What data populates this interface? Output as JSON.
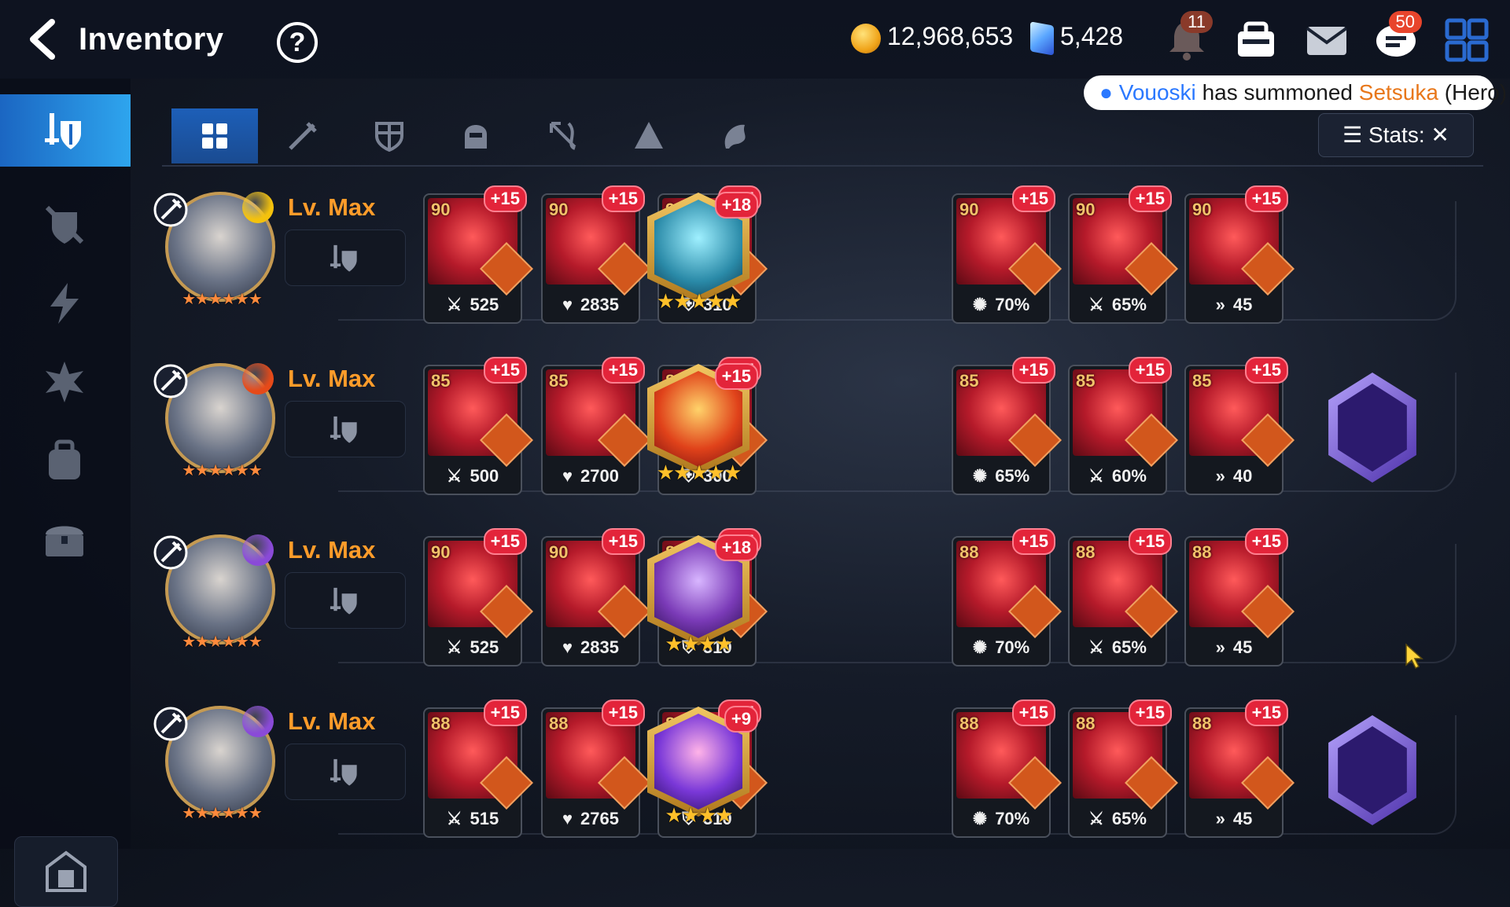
{
  "header": {
    "title": "Inventory",
    "help": "?",
    "gold": "12,968,653",
    "crystals": "5,428",
    "notification_count": "11",
    "chat_count": "50"
  },
  "tooltip": {
    "player": "Vouoski",
    "middle": "has summoned",
    "hero": "Setsuka",
    "suffix": "(Hero)"
  },
  "stats_button": {
    "label": "Stats:"
  },
  "sidebar": {
    "items": [
      "all-gear-icon",
      "no-gear-icon",
      "lightning-icon",
      "shatter-icon",
      "backpack-icon",
      "chest-icon"
    ],
    "bottom": "storage-icon"
  },
  "tabs": [
    "all",
    "weapon",
    "armor",
    "helmet",
    "bow",
    "accessory",
    "boots"
  ],
  "colors": {
    "accent": "#2ea5ee",
    "level": "#ff9c2a",
    "plus": "#e3243a"
  },
  "heroes": [
    {
      "level": "Lv. Max",
      "element": "light",
      "items": [
        {
          "lvl": "90",
          "plus": "+15",
          "stat_icon": "attack-icon",
          "stat": "525"
        },
        {
          "lvl": "90",
          "plus": "+15",
          "stat_icon": "health-icon",
          "stat": "2835"
        },
        {
          "lvl": "90",
          "plus": "+15",
          "stat_icon": "defense-icon",
          "stat": "310"
        },
        {
          "lvl": "90",
          "plus": "+15",
          "stat_icon": "crit-icon",
          "stat": "70%"
        },
        {
          "lvl": "90",
          "plus": "+15",
          "stat_icon": "attack-icon",
          "stat": "65%"
        },
        {
          "lvl": "90",
          "plus": "+15",
          "stat_icon": "speed-icon",
          "stat": "45"
        }
      ],
      "artifact_plus": "+18",
      "exclusive": false
    },
    {
      "level": "Lv. Max",
      "element": "fire",
      "items": [
        {
          "lvl": "85",
          "plus": "+15",
          "stat_icon": "attack-icon",
          "stat": "500"
        },
        {
          "lvl": "85",
          "plus": "+15",
          "stat_icon": "health-icon",
          "stat": "2700"
        },
        {
          "lvl": "85",
          "plus": "+15",
          "stat_icon": "defense-icon",
          "stat": "300"
        },
        {
          "lvl": "85",
          "plus": "+15",
          "stat_icon": "crit-icon",
          "stat": "65%"
        },
        {
          "lvl": "85",
          "plus": "+15",
          "stat_icon": "attack-icon",
          "stat": "60%"
        },
        {
          "lvl": "85",
          "plus": "+15",
          "stat_icon": "speed-icon",
          "stat": "40"
        }
      ],
      "artifact_plus": "+15",
      "exclusive": true
    },
    {
      "level": "Lv. Max",
      "element": "dark",
      "items": [
        {
          "lvl": "90",
          "plus": "+15",
          "stat_icon": "attack-icon",
          "stat": "525"
        },
        {
          "lvl": "90",
          "plus": "+15",
          "stat_icon": "health-icon",
          "stat": "2835"
        },
        {
          "lvl": "88",
          "plus": "+15",
          "stat_icon": "defense-icon",
          "stat": "310"
        },
        {
          "lvl": "88",
          "plus": "+15",
          "stat_icon": "crit-icon",
          "stat": "70%"
        },
        {
          "lvl": "88",
          "plus": "+15",
          "stat_icon": "attack-icon",
          "stat": "65%"
        },
        {
          "lvl": "88",
          "plus": "+15",
          "stat_icon": "speed-icon",
          "stat": "45"
        }
      ],
      "artifact_plus": "+18",
      "exclusive": false
    },
    {
      "level": "Lv. Max",
      "element": "dark",
      "items": [
        {
          "lvl": "88",
          "plus": "+15",
          "stat_icon": "attack-icon",
          "stat": "515"
        },
        {
          "lvl": "88",
          "plus": "+15",
          "stat_icon": "health-icon",
          "stat": "2765"
        },
        {
          "lvl": "88",
          "plus": "+15",
          "stat_icon": "defense-icon",
          "stat": "310"
        },
        {
          "lvl": "88",
          "plus": "+15",
          "stat_icon": "crit-icon",
          "stat": "70%"
        },
        {
          "lvl": "88",
          "plus": "+15",
          "stat_icon": "attack-icon",
          "stat": "65%"
        },
        {
          "lvl": "88",
          "plus": "+15",
          "stat_icon": "speed-icon",
          "stat": "45"
        }
      ],
      "artifact_plus": "+9",
      "exclusive": true
    }
  ]
}
